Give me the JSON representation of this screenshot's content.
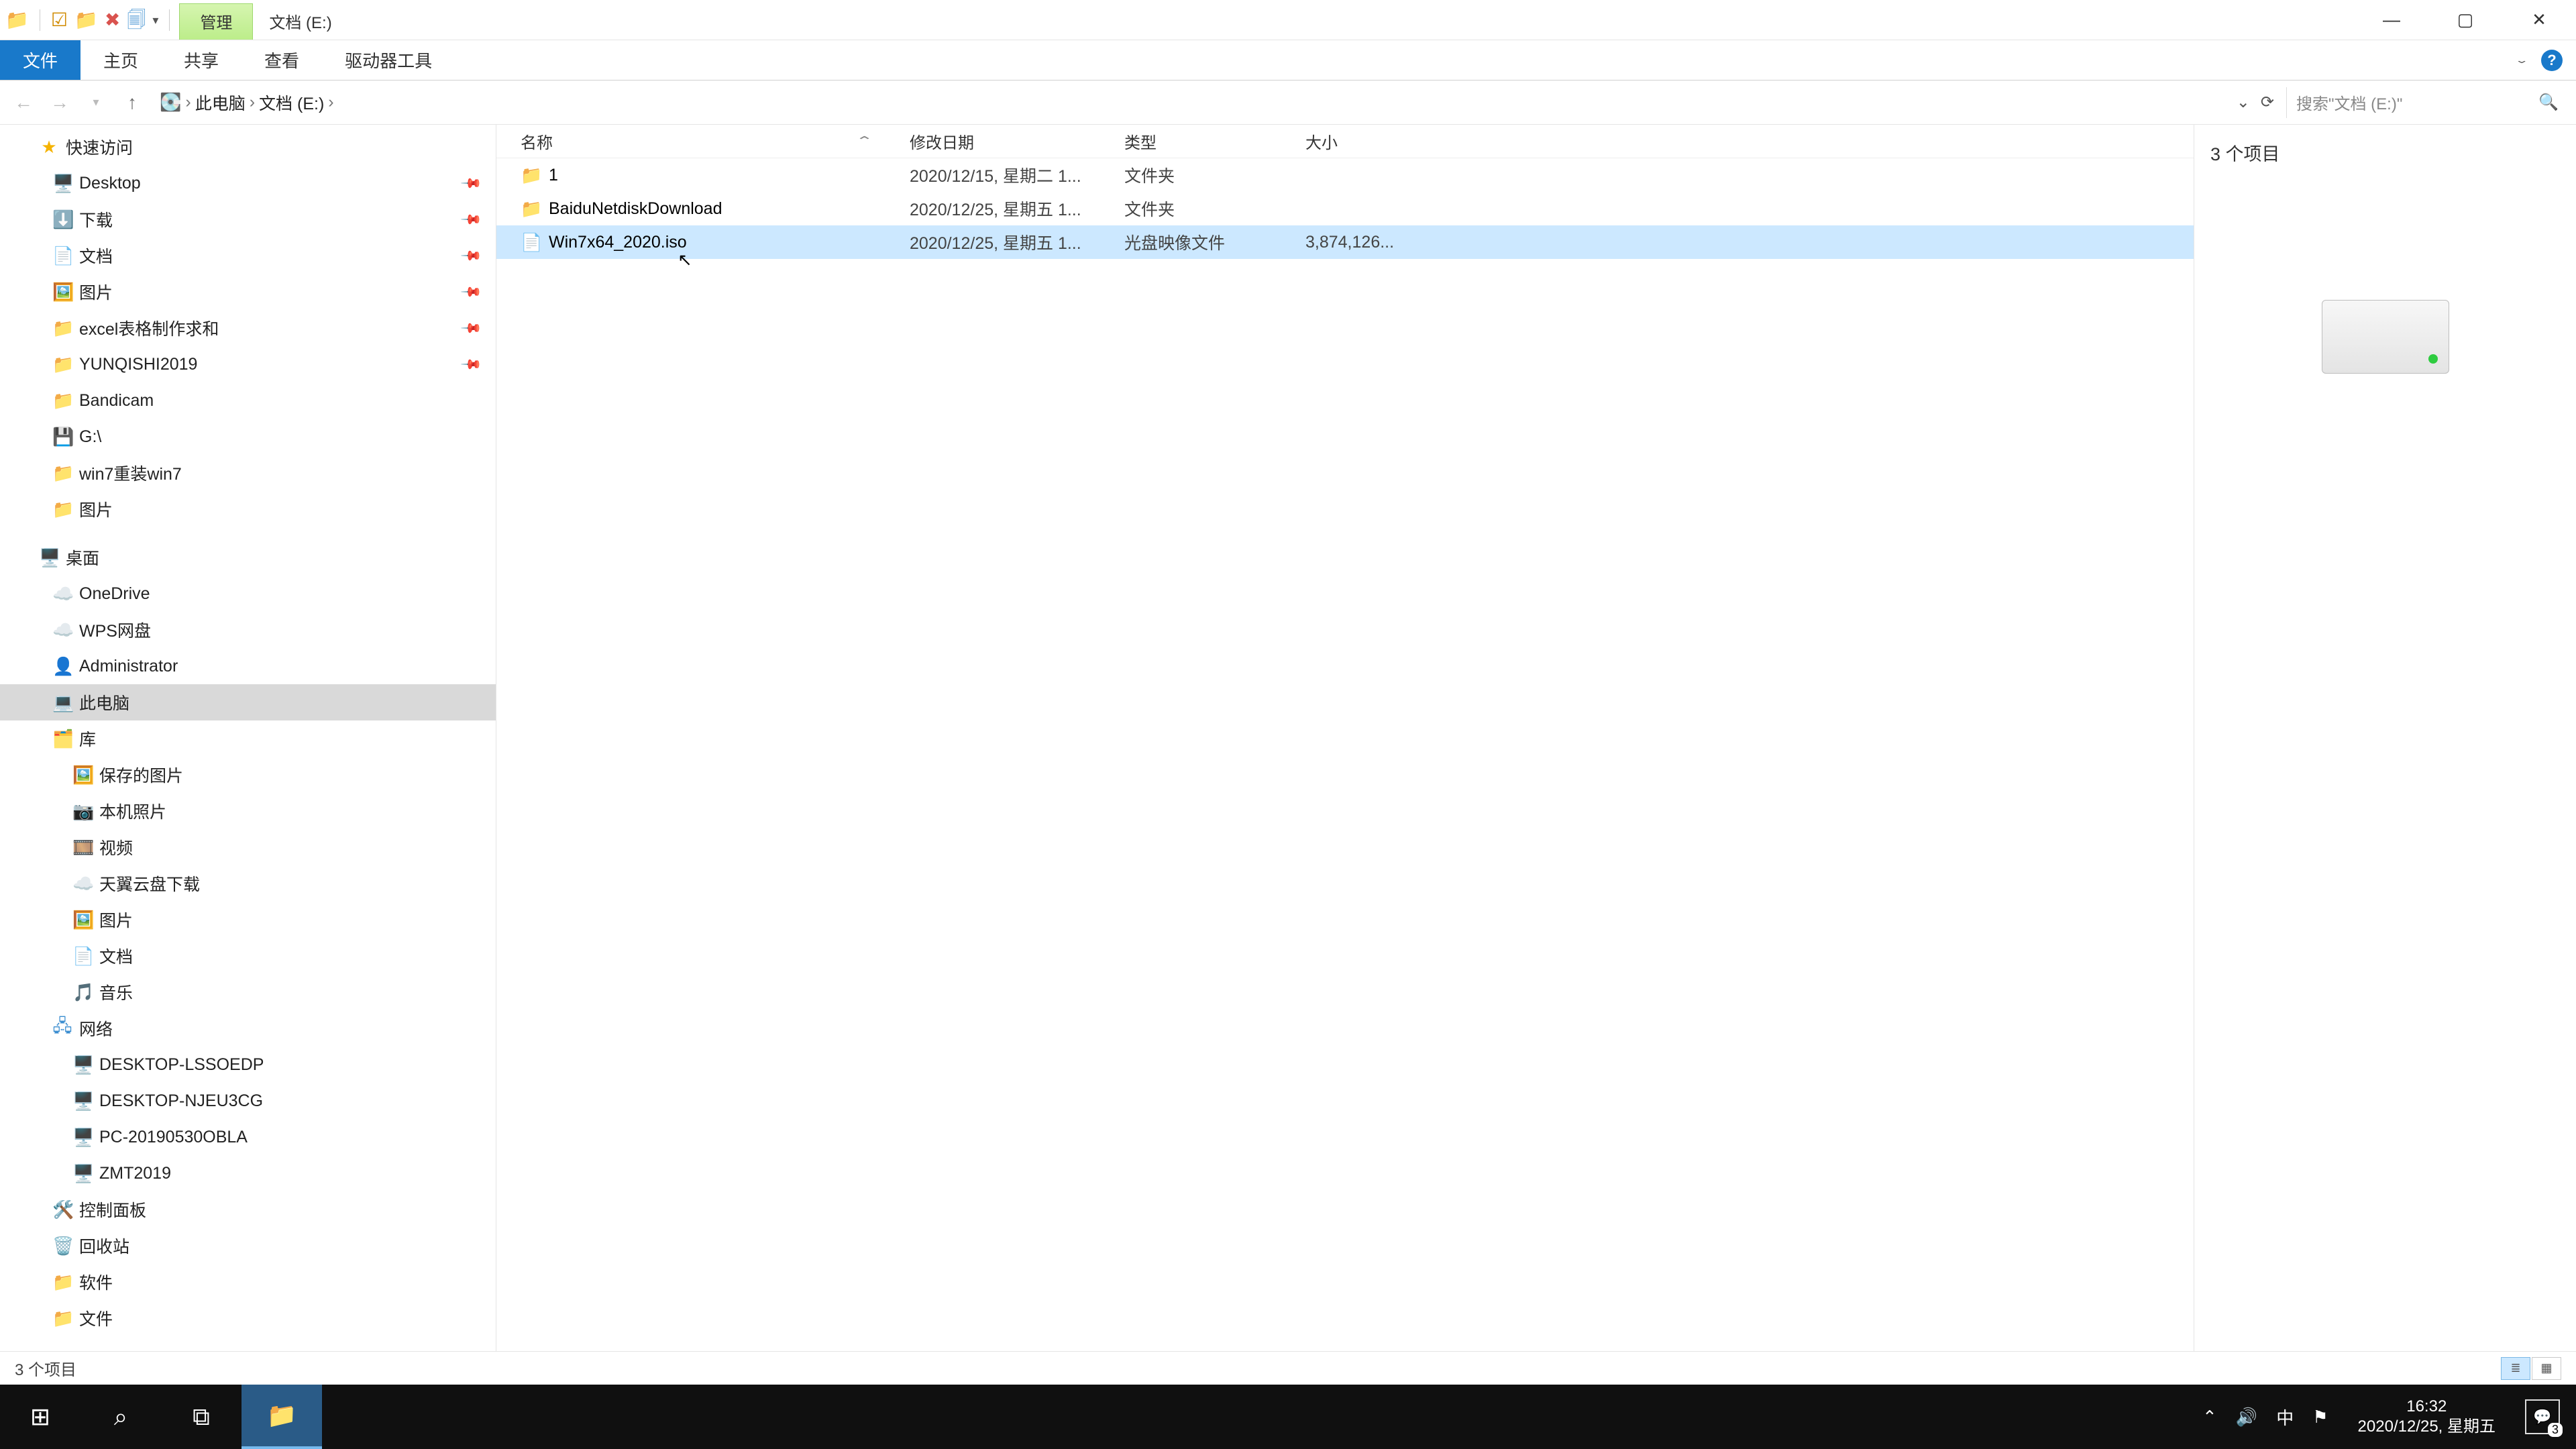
{
  "titlebar": {
    "manage_tab": "管理",
    "location_label": "文档 (E:)"
  },
  "ribbon": {
    "file": "文件",
    "home": "主页",
    "share": "共享",
    "view": "查看",
    "drive_tools": "驱动器工具"
  },
  "breadcrumb": {
    "this_pc": "此电脑",
    "drive": "文档 (E:)"
  },
  "search": {
    "placeholder": "搜索\"文档 (E:)\""
  },
  "tree": {
    "quick_access": "快速访问",
    "quick_items": [
      {
        "icon": "🖥️",
        "label": "Desktop",
        "pinned": true
      },
      {
        "icon": "⬇️",
        "label": "下载",
        "pinned": true
      },
      {
        "icon": "📄",
        "label": "文档",
        "pinned": true
      },
      {
        "icon": "🖼️",
        "label": "图片",
        "pinned": true
      },
      {
        "icon": "📁",
        "label": "excel表格制作求和",
        "pinned": true
      },
      {
        "icon": "📁",
        "label": "YUNQISHI2019",
        "pinned": true
      },
      {
        "icon": "📁",
        "label": "Bandicam",
        "pinned": false
      },
      {
        "icon": "💾",
        "label": "G:\\",
        "pinned": false
      },
      {
        "icon": "📁",
        "label": "win7重装win7",
        "pinned": false
      },
      {
        "icon": "📁",
        "label": "图片",
        "pinned": false
      }
    ],
    "desktop": "桌面",
    "onedrive": "OneDrive",
    "wps": "WPS网盘",
    "admin": "Administrator",
    "this_pc": "此电脑",
    "libraries": "库",
    "lib_items": [
      {
        "icon": "🖼️",
        "label": "保存的图片"
      },
      {
        "icon": "📷",
        "label": "本机照片"
      },
      {
        "icon": "🎞️",
        "label": "视频"
      },
      {
        "icon": "☁️",
        "label": "天翼云盘下载"
      },
      {
        "icon": "🖼️",
        "label": "图片"
      },
      {
        "icon": "📄",
        "label": "文档"
      },
      {
        "icon": "🎵",
        "label": "音乐"
      }
    ],
    "network": "网络",
    "net_items": [
      {
        "label": "DESKTOP-LSSOEDP"
      },
      {
        "label": "DESKTOP-NJEU3CG"
      },
      {
        "label": "PC-20190530OBLA"
      },
      {
        "label": "ZMT2019"
      }
    ],
    "control_panel": "控制面板",
    "recycle": "回收站",
    "software": "软件",
    "files": "文件"
  },
  "columns": {
    "name": "名称",
    "date": "修改日期",
    "type": "类型",
    "size": "大小"
  },
  "rows": [
    {
      "icon": "📁",
      "icon_class": "folder-ico",
      "name": "1",
      "date": "2020/12/15, 星期二 1...",
      "type": "文件夹",
      "size": "",
      "selected": false
    },
    {
      "icon": "📁",
      "icon_class": "folder-ico",
      "name": "BaiduNetdiskDownload",
      "date": "2020/12/25, 星期五 1...",
      "type": "文件夹",
      "size": "",
      "selected": false
    },
    {
      "icon": "📄",
      "icon_class": "file-ico",
      "name": "Win7x64_2020.iso",
      "date": "2020/12/25, 星期五 1...",
      "type": "光盘映像文件",
      "size": "3,874,126...",
      "selected": true
    }
  ],
  "preview": {
    "count": "3 个项目"
  },
  "status": {
    "count": "3 个项目"
  },
  "taskbar": {
    "time": "16:32",
    "date": "2020/12/25, 星期五",
    "ime": "中",
    "notif_count": "3"
  }
}
